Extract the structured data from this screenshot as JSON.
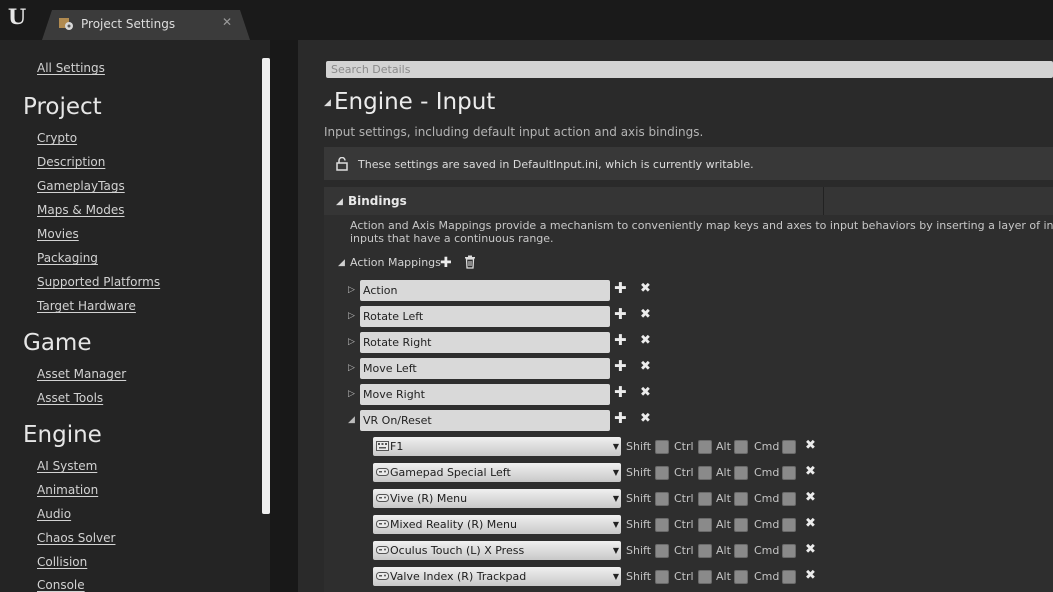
{
  "window": {
    "tab_title": "Project Settings"
  },
  "sidebar": {
    "top_link": "All Settings",
    "sections": [
      {
        "title": "Project",
        "items": [
          "Crypto",
          "Description",
          "GameplayTags",
          "Maps & Modes",
          "Movies",
          "Packaging",
          "Supported Platforms",
          "Target Hardware"
        ]
      },
      {
        "title": "Game",
        "items": [
          "Asset Manager",
          "Asset Tools"
        ]
      },
      {
        "title": "Engine",
        "items": [
          "AI System",
          "Animation",
          "Audio",
          "Chaos Solver",
          "Collision",
          "Console"
        ]
      }
    ]
  },
  "search": {
    "placeholder": "Search Details"
  },
  "header": {
    "title": "Engine - Input",
    "description": "Input settings, including default input action and axis bindings.",
    "notice": "These settings are saved in DefaultInput.ini, which is currently writable."
  },
  "bindings": {
    "title": "Bindings",
    "description_line1": "Action and Axis Mappings provide a mechanism to conveniently map keys and axes to input behaviors by inserting a layer of indirection betw",
    "description_line2": "inputs that have a continuous range.",
    "action_mappings_label": "Action Mappings",
    "actions": [
      "Action",
      "Rotate Left",
      "Rotate Right",
      "Move Left",
      "Move Right",
      "VR On/Reset"
    ],
    "expanded_keys": [
      "F1",
      "Gamepad Special Left",
      "Vive (R) Menu",
      "Mixed Reality (R) Menu",
      "Oculus Touch (L) X Press",
      "Valve Index (R) Trackpad"
    ],
    "modifiers": [
      "Shift",
      "Ctrl",
      "Alt",
      "Cmd"
    ]
  }
}
